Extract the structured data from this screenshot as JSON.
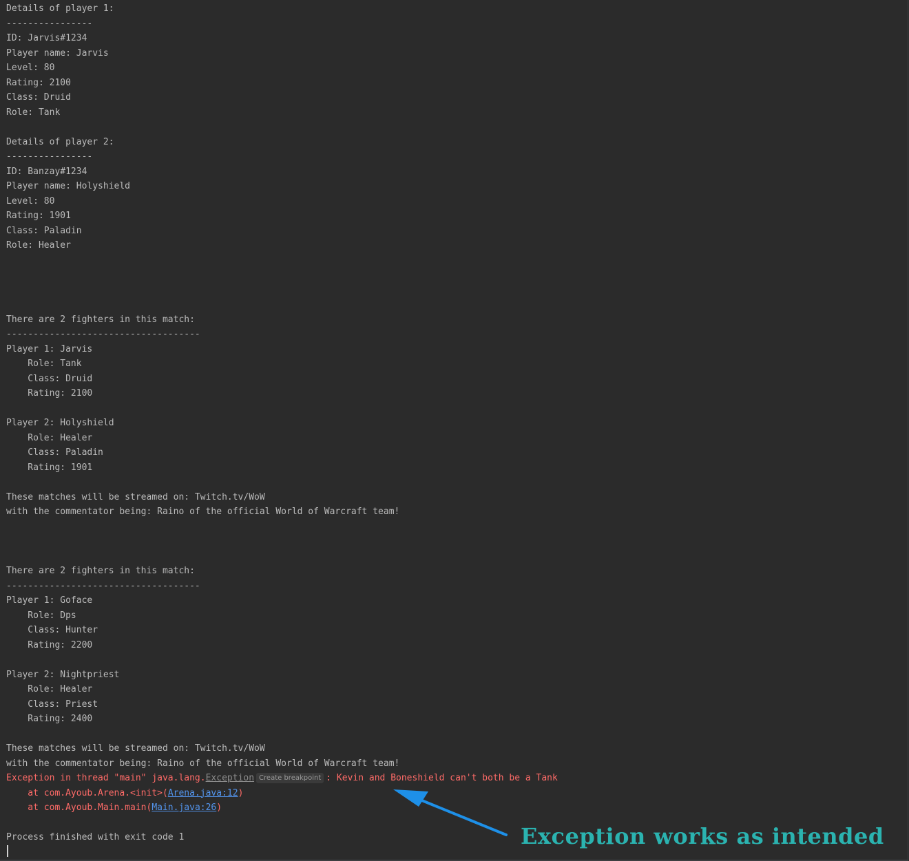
{
  "console": {
    "lines": [
      {
        "text": "Details of player 1:"
      },
      {
        "text": "----------------"
      },
      {
        "text": "ID: Jarvis#1234"
      },
      {
        "text": "Player name: Jarvis"
      },
      {
        "text": "Level: 80"
      },
      {
        "text": "Rating: 2100"
      },
      {
        "text": "Class: Druid"
      },
      {
        "text": "Role: Tank"
      },
      {
        "text": ""
      },
      {
        "text": "Details of player 2:"
      },
      {
        "text": "----------------"
      },
      {
        "text": "ID: Banzay#1234"
      },
      {
        "text": "Player name: Holyshield"
      },
      {
        "text": "Level: 80"
      },
      {
        "text": "Rating: 1901"
      },
      {
        "text": "Class: Paladin"
      },
      {
        "text": "Role: Healer"
      },
      {
        "text": ""
      },
      {
        "text": ""
      },
      {
        "text": ""
      },
      {
        "text": ""
      },
      {
        "text": "There are 2 fighters in this match:"
      },
      {
        "text": "------------------------------------"
      },
      {
        "text": "Player 1: Jarvis"
      },
      {
        "text": "    Role: Tank"
      },
      {
        "text": "    Class: Druid"
      },
      {
        "text": "    Rating: 2100"
      },
      {
        "text": ""
      },
      {
        "text": "Player 2: Holyshield"
      },
      {
        "text": "    Role: Healer"
      },
      {
        "text": "    Class: Paladin"
      },
      {
        "text": "    Rating: 1901"
      },
      {
        "text": ""
      },
      {
        "text": "These matches will be streamed on: Twitch.tv/WoW"
      },
      {
        "text": "with the commentator being: Raino of the official World of Warcraft team!"
      },
      {
        "text": ""
      },
      {
        "text": ""
      },
      {
        "text": ""
      },
      {
        "text": "There are 2 fighters in this match:"
      },
      {
        "text": "------------------------------------"
      },
      {
        "text": "Player 1: Goface"
      },
      {
        "text": "    Role: Dps"
      },
      {
        "text": "    Class: Hunter"
      },
      {
        "text": "    Rating: 2200"
      },
      {
        "text": ""
      },
      {
        "text": "Player 2: Nightpriest"
      },
      {
        "text": "    Role: Healer"
      },
      {
        "text": "    Class: Priest"
      },
      {
        "text": "    Rating: 2400"
      },
      {
        "text": ""
      },
      {
        "text": "These matches will be streamed on: Twitch.tv/WoW"
      },
      {
        "text": "with the commentator being: Raino of the official World of Warcraft team!"
      }
    ],
    "exception": {
      "prefix": "Exception in thread \"main\" java.lang.",
      "class_link": "Exception",
      "breakpoint_label": "Create breakpoint",
      "message": ": Kevin and Boneshield can't both be a Tank",
      "stack": [
        {
          "prefix": "    at com.Ayoub.Arena.<init>(",
          "link": "Arena.java:12",
          "suffix": ")"
        },
        {
          "prefix": "    at com.Ayoub.Main.main(",
          "link": "Main.java:26",
          "suffix": ")"
        }
      ]
    },
    "exit_message": "Process finished with exit code 1"
  },
  "annotation": {
    "text": "Exception works as intended",
    "color": "#2bb3b0",
    "arrow_color": "#1e90e8"
  }
}
